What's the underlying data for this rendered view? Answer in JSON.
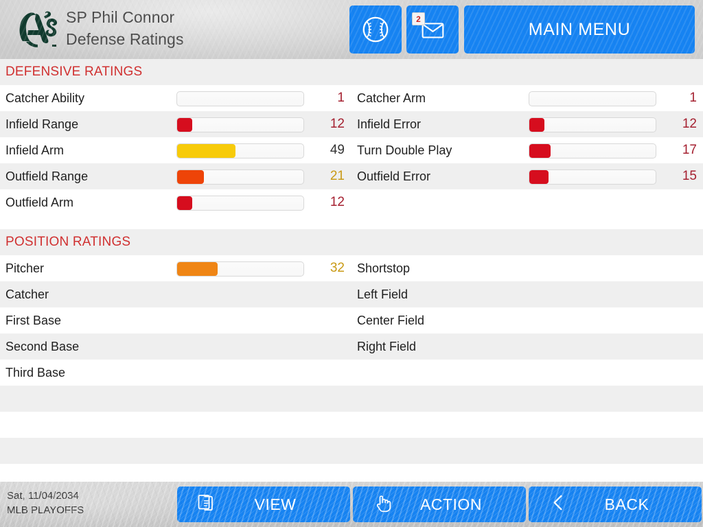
{
  "header": {
    "team_logo": "athletics-as-logo",
    "title_line1": "SP Phil Connor",
    "title_line2": "Defense Ratings",
    "buttons": {
      "lineup_icon": "baseball-icon",
      "mail_icon": "envelope-icon",
      "mail_badge": "2",
      "main_menu_label": "MAIN MENU"
    }
  },
  "colors": {
    "accent_blue": "#1683f2",
    "section_red": "#d03030",
    "bar_red": "#d60d1e",
    "bar_yellow": "#f7cb0a",
    "bar_orange_red": "#ee4408",
    "bar_orange": "#ef8515",
    "value_red": "#a52030",
    "value_gold": "#c99a15",
    "value_dark": "#333333",
    "row_alt": "#efefef",
    "row_base": "#ffffff"
  },
  "sections": [
    {
      "title": "DEFENSIVE RATINGS",
      "rows": [
        {
          "left": {
            "label": "Catcher Ability",
            "value": "1",
            "pct": 0,
            "fill": "none",
            "value_color": "#a52030",
            "has_bar": true
          },
          "right": {
            "label": "Catcher Arm",
            "value": "1",
            "pct": 0,
            "fill": "none",
            "value_color": "#a52030",
            "has_bar": true
          }
        },
        {
          "left": {
            "label": "Infield Range",
            "value": "12",
            "pct": 12,
            "fill": "#d60d1e",
            "value_color": "#a52030",
            "has_bar": true
          },
          "right": {
            "label": "Infield Error",
            "value": "12",
            "pct": 12,
            "fill": "#d60d1e",
            "value_color": "#a52030",
            "has_bar": true
          }
        },
        {
          "left": {
            "label": "Infield Arm",
            "value": "49",
            "pct": 46,
            "fill": "#f7cb0a",
            "value_color": "#333333",
            "has_bar": true
          },
          "right": {
            "label": "Turn Double Play",
            "value": "17",
            "pct": 17,
            "fill": "#d60d1e",
            "value_color": "#a52030",
            "has_bar": true
          }
        },
        {
          "left": {
            "label": "Outfield Range",
            "value": "21",
            "pct": 21,
            "fill": "#ee4408",
            "value_color": "#c99a15",
            "has_bar": true
          },
          "right": {
            "label": "Outfield Error",
            "value": "15",
            "pct": 15,
            "fill": "#d60d1e",
            "value_color": "#a52030",
            "has_bar": true
          }
        },
        {
          "left": {
            "label": "Outfield Arm",
            "value": "12",
            "pct": 12,
            "fill": "#d60d1e",
            "value_color": "#a52030",
            "has_bar": true
          },
          "right": {
            "label": "",
            "value": "",
            "pct": 0,
            "fill": "none",
            "value_color": "#a52030",
            "has_bar": false
          }
        }
      ]
    },
    {
      "title": "POSITION RATINGS",
      "rows": [
        {
          "left": {
            "label": "Pitcher",
            "value": "32",
            "pct": 32,
            "fill": "#ef8515",
            "value_color": "#c99a15",
            "has_bar": true
          },
          "right": {
            "label": "Shortstop",
            "value": "",
            "pct": 0,
            "fill": "none",
            "value_color": "#a52030",
            "has_bar": false
          }
        },
        {
          "left": {
            "label": "Catcher",
            "value": "",
            "pct": 0,
            "fill": "none",
            "value_color": "#a52030",
            "has_bar": false
          },
          "right": {
            "label": "Left Field",
            "value": "",
            "pct": 0,
            "fill": "none",
            "value_color": "#a52030",
            "has_bar": false
          }
        },
        {
          "left": {
            "label": "First Base",
            "value": "",
            "pct": 0,
            "fill": "none",
            "value_color": "#a52030",
            "has_bar": false
          },
          "right": {
            "label": "Center Field",
            "value": "",
            "pct": 0,
            "fill": "none",
            "value_color": "#a52030",
            "has_bar": false
          }
        },
        {
          "left": {
            "label": "Second Base",
            "value": "",
            "pct": 0,
            "fill": "none",
            "value_color": "#a52030",
            "has_bar": false
          },
          "right": {
            "label": "Right Field",
            "value": "",
            "pct": 0,
            "fill": "none",
            "value_color": "#a52030",
            "has_bar": false
          }
        },
        {
          "left": {
            "label": "Third Base",
            "value": "",
            "pct": 0,
            "fill": "none",
            "value_color": "#a52030",
            "has_bar": false
          },
          "right": {
            "label": "",
            "value": "",
            "pct": 0,
            "fill": "none",
            "value_color": "#a52030",
            "has_bar": false
          }
        },
        {
          "left": {
            "label": "",
            "value": "",
            "pct": 0,
            "fill": "none",
            "value_color": "#a52030",
            "has_bar": false
          },
          "right": {
            "label": "",
            "value": "",
            "pct": 0,
            "fill": "none",
            "value_color": "#a52030",
            "has_bar": false
          }
        },
        {
          "left": {
            "label": "",
            "value": "",
            "pct": 0,
            "fill": "none",
            "value_color": "#a52030",
            "has_bar": false
          },
          "right": {
            "label": "",
            "value": "",
            "pct": 0,
            "fill": "none",
            "value_color": "#a52030",
            "has_bar": false
          }
        },
        {
          "left": {
            "label": "",
            "value": "",
            "pct": 0,
            "fill": "none",
            "value_color": "#a52030",
            "has_bar": false
          },
          "right": {
            "label": "",
            "value": "",
            "pct": 0,
            "fill": "none",
            "value_color": "#a52030",
            "has_bar": false
          }
        },
        {
          "left": {
            "label": "",
            "value": "",
            "pct": 0,
            "fill": "none",
            "value_color": "#a52030",
            "has_bar": false
          },
          "right": {
            "label": "",
            "value": "",
            "pct": 0,
            "fill": "none",
            "value_color": "#a52030",
            "has_bar": false
          }
        }
      ]
    }
  ],
  "footer": {
    "date": "Sat, 11/04/2034",
    "league": "MLB PLAYOFFS",
    "buttons": [
      {
        "label": "VIEW",
        "icon": "document-copy-icon",
        "name": "view-button"
      },
      {
        "label": "ACTION",
        "icon": "hand-pointer-icon",
        "name": "action-button"
      },
      {
        "label": "BACK",
        "icon": "chevron-left-icon",
        "name": "back-button"
      }
    ]
  }
}
